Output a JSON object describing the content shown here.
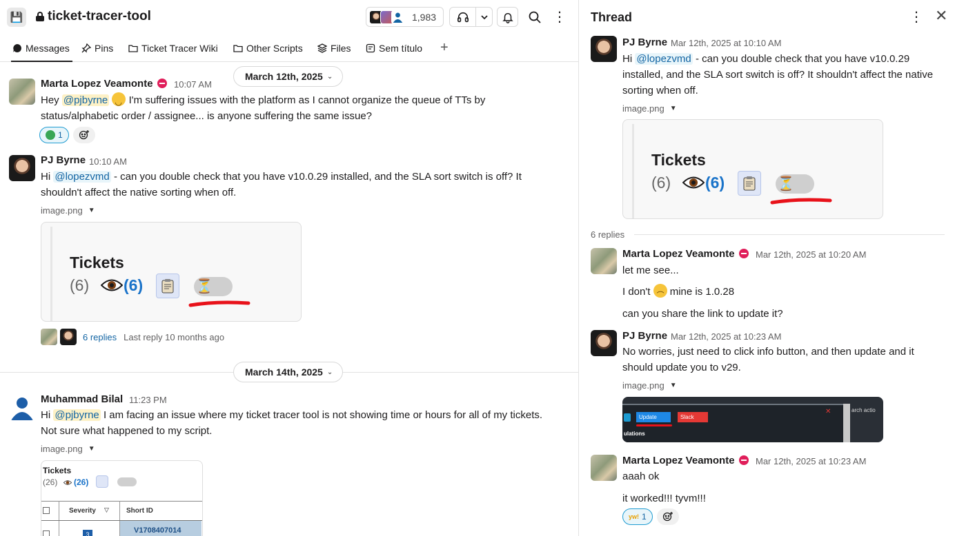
{
  "channel": {
    "name": "ticket-tracer-tool",
    "member_count": "1,983",
    "tabs": [
      {
        "label": "Messages",
        "icon": "message-icon"
      },
      {
        "label": "Pins",
        "icon": "pin-icon"
      },
      {
        "label": "Ticket Tracer Wiki",
        "icon": "folder-icon"
      },
      {
        "label": "Other Scripts",
        "icon": "folder-icon"
      },
      {
        "label": "Files",
        "icon": "layers-icon"
      },
      {
        "label": "Sem título",
        "icon": "canvas-icon"
      }
    ],
    "dates": [
      "March 12th, 2025",
      "March 14th, 2025"
    ],
    "messages": [
      {
        "author": "Marta Lopez Veamonte",
        "time": "10:07 AM",
        "text_pre": "Hey ",
        "mention": "@pjbyrne",
        "text_post1": " I'm suffering issues with the platform as I cannot organize the queue of TTs by",
        "text_post2": "status/alphabetic order / assignee... is anyone suffering the same issue?",
        "reaction_count": "1"
      },
      {
        "author": "PJ Byrne",
        "time": "10:10 AM",
        "text_pre": "Hi ",
        "mention": "@lopezvmd",
        "text_post1": " - can you double check that you have v10.0.29 installed, and the SLA sort switch is off? It",
        "text_post2": "shouldn't affect the native sorting when off.",
        "file": "image.png",
        "image": {
          "title": "Tickets",
          "count": "(6)",
          "blue": "(6)"
        },
        "replies": "6 replies",
        "last_reply": "Last reply 10 months ago"
      },
      {
        "author": "Muhammad Bilal",
        "time": "11:23 PM",
        "text_pre": "Hi ",
        "mention": "@pjbyrne",
        "text_post1": " I am facing an issue where my ticket tracer tool is not showing time or hours for all of my tickets.",
        "text_post2": "Not sure what happened to my script.",
        "file": "image.png",
        "image": {
          "title": "Tickets",
          "count": "(26)",
          "blue": "(26)",
          "col1": "Severity",
          "col2": "Short ID",
          "cell": "V1708407014",
          "sev": "3"
        }
      }
    ]
  },
  "thread": {
    "title": "Thread",
    "parent": {
      "author": "PJ Byrne",
      "time": "Mar 12th, 2025 at 10:10 AM",
      "text_pre": "Hi ",
      "mention": "@lopezvmd",
      "text_post1": " - can you double check that you have v10.0.29",
      "text_post2": "installed, and the SLA sort switch is off? It shouldn't affect the native",
      "text_post3": "sorting when off.",
      "file": "image.png",
      "image": {
        "title": "Tickets",
        "count": "(6)",
        "blue": "(6)"
      }
    },
    "replies_label": "6 replies",
    "replies": [
      {
        "author": "Marta Lopez Veamonte",
        "time": "Mar 12th, 2025 at 10:20 AM",
        "line1": "let me see...",
        "line2_pre": "I don't ",
        "line2_post": " mine is  1.0.28",
        "line3": "can you share the link to update it?"
      },
      {
        "author": "PJ Byrne",
        "time": "Mar 12th, 2025 at 10:23 AM",
        "line1": "No worries, just need to click info button, and then update and it",
        "line2": "should update you to v29.",
        "file": "image.png",
        "image": {
          "update": "Update",
          "slack": "Slack",
          "bottom": "ulations",
          "top": "arch actio"
        }
      },
      {
        "author": "Marta Lopez Veamonte",
        "time": "Mar 12th, 2025 at 10:23 AM",
        "line1": "aaah ok",
        "line2": "it worked!!! tyvm!!!",
        "reaction_label": "yw!",
        "reaction_count": "1"
      }
    ]
  }
}
